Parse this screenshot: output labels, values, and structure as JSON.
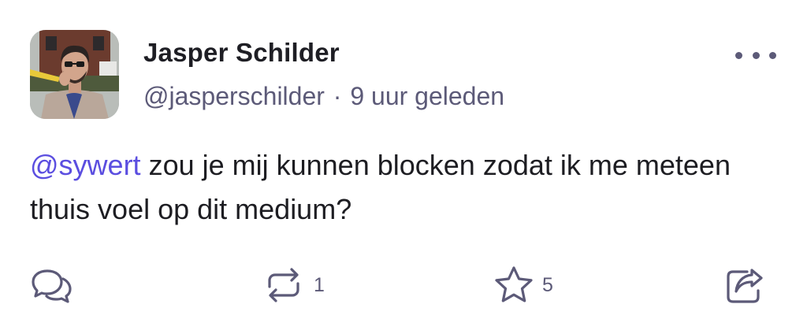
{
  "post": {
    "author": {
      "display_name": "Jasper Schilder",
      "handle": "@jasperschilder",
      "separator": "·",
      "time_ago": "9 uur geleden"
    },
    "content": {
      "mention": "@sywert",
      "text": " zou je mij kunnen blocken zodat ik me meteen thuis voel op dit medium?"
    },
    "actions": {
      "reply": {
        "icon": "reply-icon"
      },
      "repost": {
        "icon": "repost-icon",
        "count": "1"
      },
      "favourite": {
        "icon": "star-icon",
        "count": "5"
      },
      "share": {
        "icon": "share-icon"
      }
    },
    "menu": {
      "icon": "more-icon"
    }
  },
  "colors": {
    "accent": "#5b4ee0",
    "secondary_text": "#5c5a78",
    "primary_text": "#1e1e24",
    "background": "#ffffff"
  }
}
